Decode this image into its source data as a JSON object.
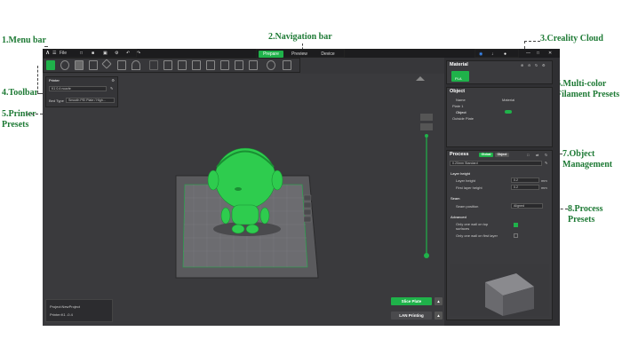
{
  "annotations": {
    "menu_bar": "1.Menu bar",
    "navigation_bar": "2.Navigation bar",
    "creality_cloud": "3.Creality Cloud",
    "toolbar": "4.Toolbar",
    "printer_presets_1": "5.Printer",
    "printer_presets_2": "Presets",
    "filament_presets_1": "6.Multi-color",
    "filament_presets_2": "Filament Presets",
    "object_mgmt_1": "7.Object",
    "object_mgmt_2": "Management",
    "process_presets_1": "8.Process",
    "process_presets_2": "Presets"
  },
  "menubar": {
    "file_label": "File"
  },
  "nav": {
    "tabs": [
      "Prepare",
      "Preview",
      "Device"
    ],
    "active": 0
  },
  "printer": {
    "title": "Printer",
    "printer_value": "K1 0.4 nozzle",
    "bed_label": "Bed Type",
    "bed_value": "Smooth PEI Plate / High..."
  },
  "material": {
    "title": "Material",
    "filament": "PLA"
  },
  "object": {
    "title": "Object",
    "col_name": "Name",
    "col_material": "Material",
    "rows": [
      "Plate 1",
      "Object",
      "Outside Plate"
    ]
  },
  "process": {
    "title": "Process",
    "tab_global": "Global",
    "tab_object": "Object",
    "preset": "0.20mm Standard",
    "layer_height_section": "Layer height",
    "layer_height_label": "Layer height",
    "layer_height_value": "0.2",
    "first_layer_label": "First layer height",
    "first_layer_value": "0.2",
    "unit": "mm",
    "seam_section": "Seam",
    "seam_position_label": "Seam position",
    "seam_position_value": "Aligned",
    "advanced_section": "Advanced",
    "adv_option_1a": "Only one wall on top",
    "adv_option_1b": "surfaces",
    "adv_option_2": "Only one wall on first layer"
  },
  "bottom": {
    "project_label": "Project:NewProject",
    "printer_label": "Printer:K1 -0.4",
    "slice_button": "Slice Plate",
    "lan_button": "LAN Printing"
  },
  "colors": {
    "accent": "#1fb24a",
    "annotation": "#1e7a35"
  }
}
